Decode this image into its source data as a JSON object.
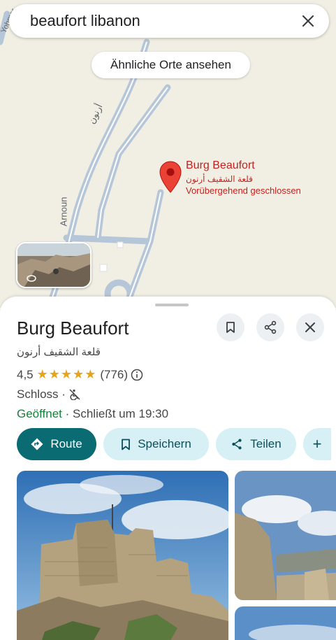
{
  "search": {
    "query": "beaufort libanon"
  },
  "map": {
    "chip_similar": "Ähnliche Orte ansehen",
    "road_labels": {
      "arabic": "أرنون",
      "arnoun": "Arnoun",
      "top_left": "Yohmor"
    },
    "pin": {
      "title": "Burg Beaufort",
      "arabic": "قلعة الشقيف أرنون",
      "status": "Vorübergehend geschlossen"
    }
  },
  "place": {
    "title": "Burg Beaufort",
    "arabic_name": "قلعة الشقيف أرنون",
    "rating": "4,5",
    "stars": "★★★★★",
    "rating_value": 4.5,
    "reviews": "(776)",
    "category": "Schloss ·",
    "open_status": "Geöffnet",
    "closes": " · Schließt um 19:30"
  },
  "actions": {
    "route": "Route",
    "save": "Speichern",
    "share": "Teilen",
    "more": "+"
  },
  "colors": {
    "accent": "#0b6b73",
    "tonal": "#d6f0f5",
    "pin": "#c5221f",
    "open": "#188038",
    "stars": "#e8a317"
  }
}
